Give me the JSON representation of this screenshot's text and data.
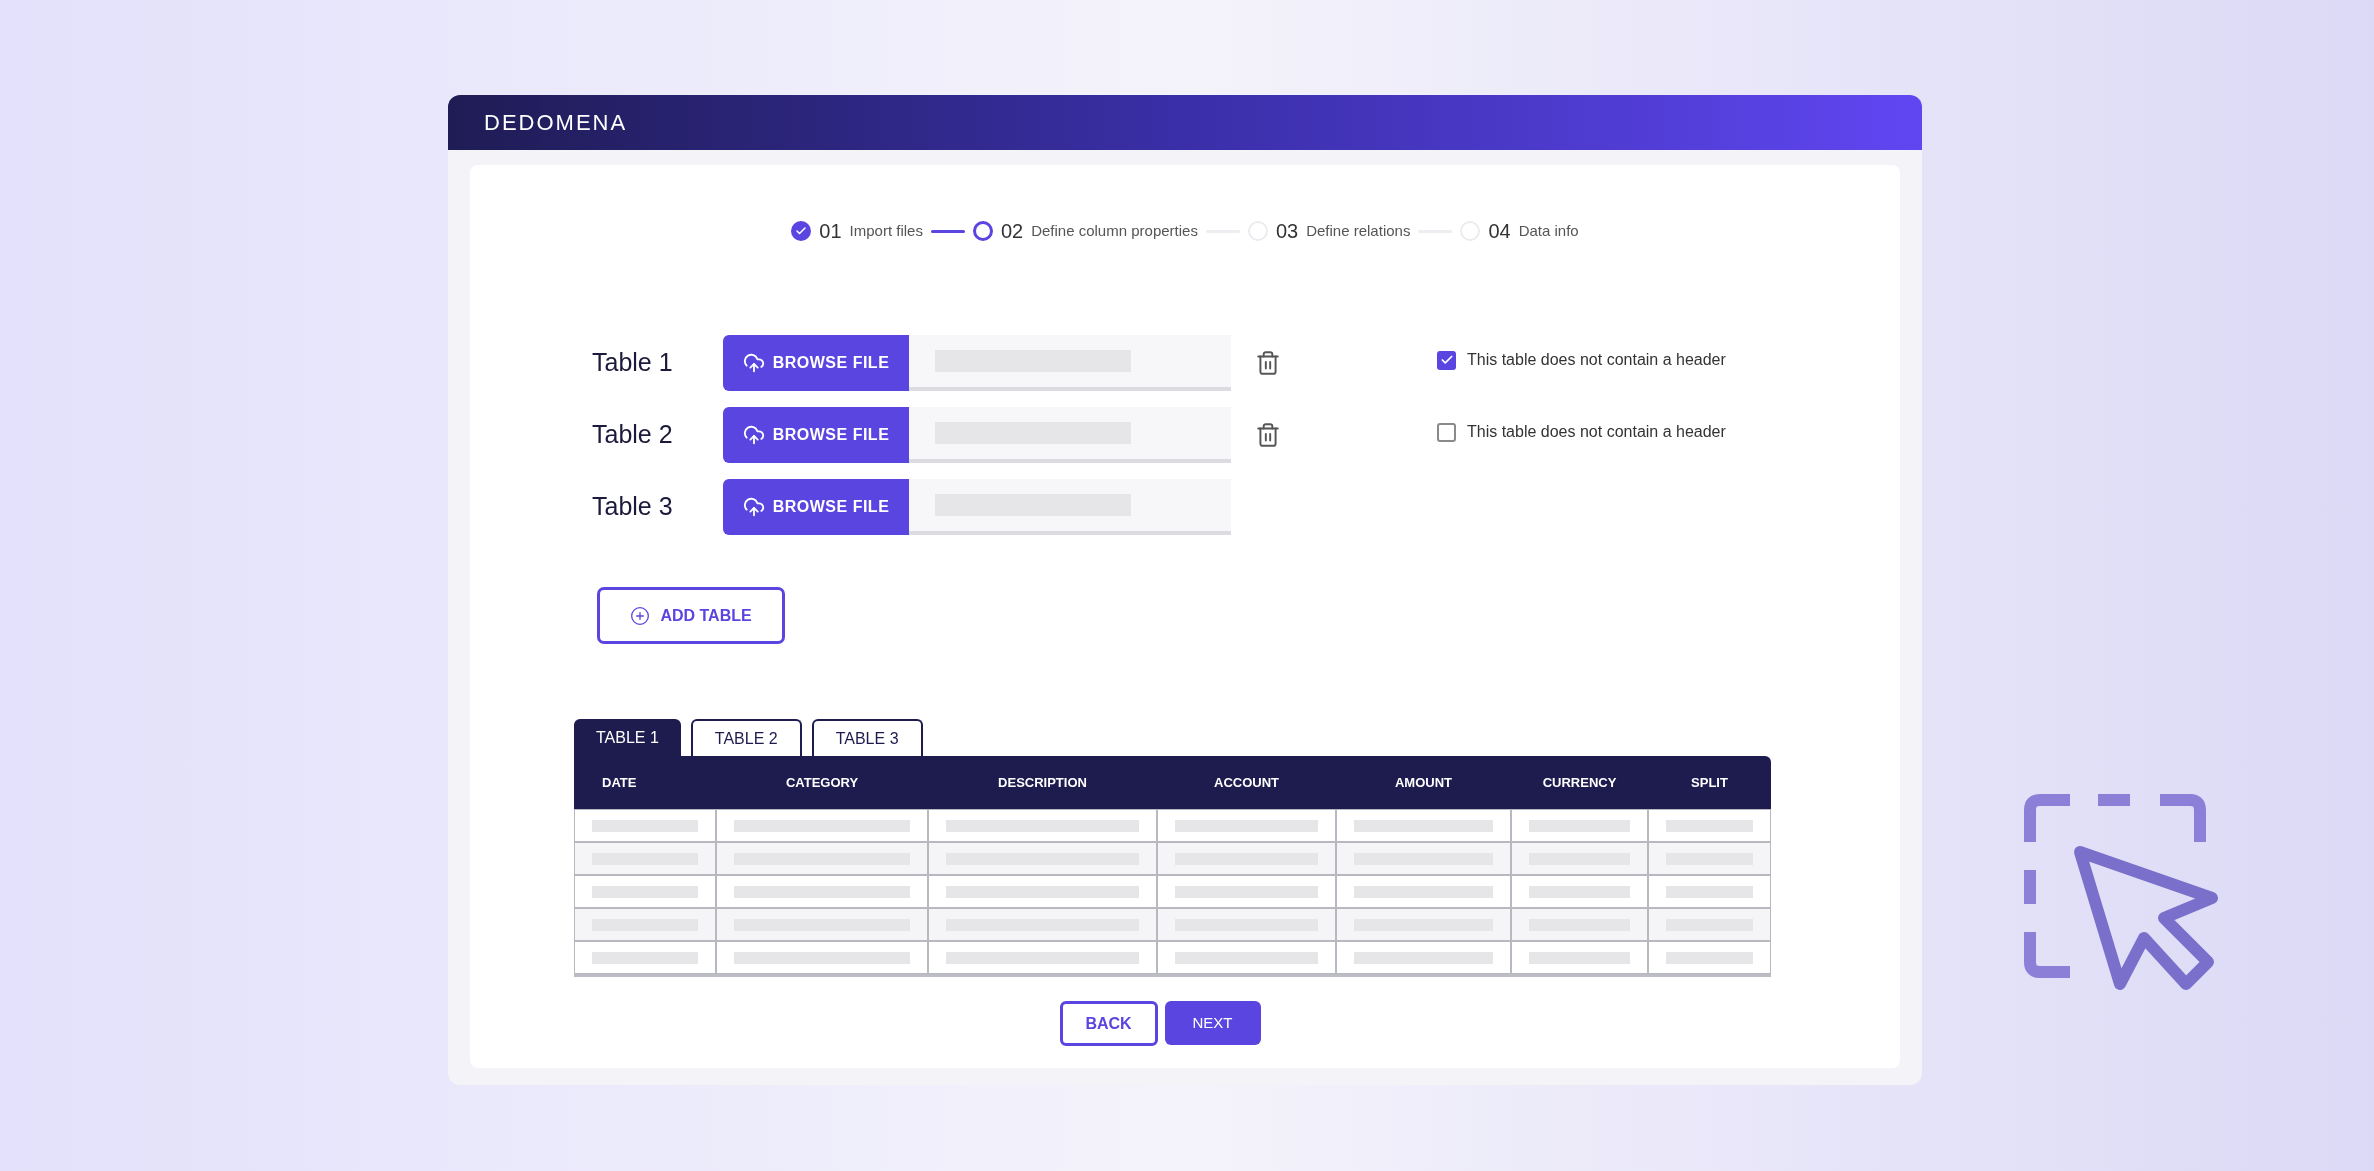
{
  "header": {
    "logo": "DEDOMENA"
  },
  "stepper": [
    {
      "number": "01",
      "label": "Import files",
      "completed": true,
      "active": false
    },
    {
      "number": "02",
      "label": "Define column properties",
      "completed": false,
      "active": true
    },
    {
      "number": "03",
      "label": "Define relations",
      "completed": false,
      "active": false
    },
    {
      "number": "04",
      "label": "Data info",
      "completed": false,
      "active": false
    }
  ],
  "uploads": [
    {
      "label": "Table 1",
      "button": "BROWSE FILE",
      "deletable": true,
      "header_option": {
        "label": "This table does not contain a header",
        "checked": true
      }
    },
    {
      "label": "Table 2",
      "button": "BROWSE FILE",
      "deletable": true,
      "header_option": {
        "label": "This table does not contain a header",
        "checked": false
      }
    },
    {
      "label": "Table 3",
      "button": "BROWSE FILE",
      "deletable": false
    }
  ],
  "add_button": "ADD TABLE",
  "tabs": [
    {
      "label": "TABLE 1",
      "selected": true
    },
    {
      "label": "TABLE 2",
      "selected": false
    },
    {
      "label": "TABLE 3",
      "selected": false
    }
  ],
  "table": {
    "columns": [
      "DATE",
      "CATEGORY",
      "DESCRIPTION",
      "ACCOUNT",
      "AMOUNT",
      "CURRENCY",
      "SPLIT"
    ],
    "rows": [
      {
        "kind": "placeholder"
      },
      {
        "kind": "placeholder"
      },
      {
        "kind": "placeholder"
      },
      {
        "kind": "placeholder"
      },
      {
        "kind": "placeholder"
      }
    ]
  },
  "buttons": {
    "back": "BACK",
    "next": "NEXT"
  }
}
